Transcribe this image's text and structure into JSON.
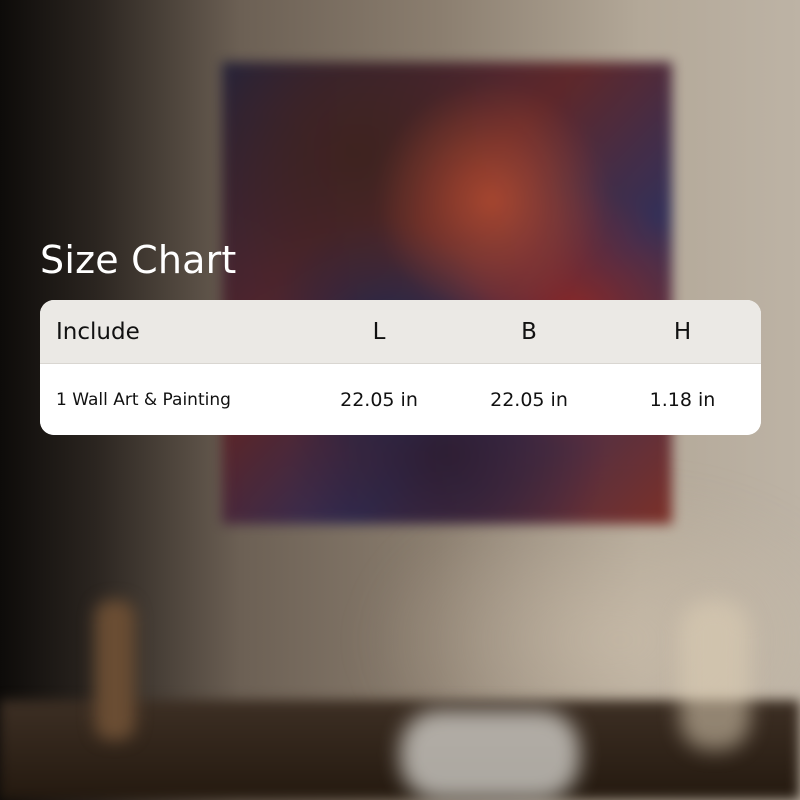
{
  "title": "Size Chart",
  "table": {
    "headers": [
      "Include",
      "L",
      "B",
      "H"
    ],
    "rows": [
      [
        "1 Wall Art & Painting",
        "22.05 in",
        "22.05 in",
        "1.18 in"
      ]
    ]
  },
  "colors": {
    "header_bg": "#ebe9e5",
    "row_bg": "#ffffff",
    "title_text": "#ffffff",
    "table_text": "#111111"
  }
}
